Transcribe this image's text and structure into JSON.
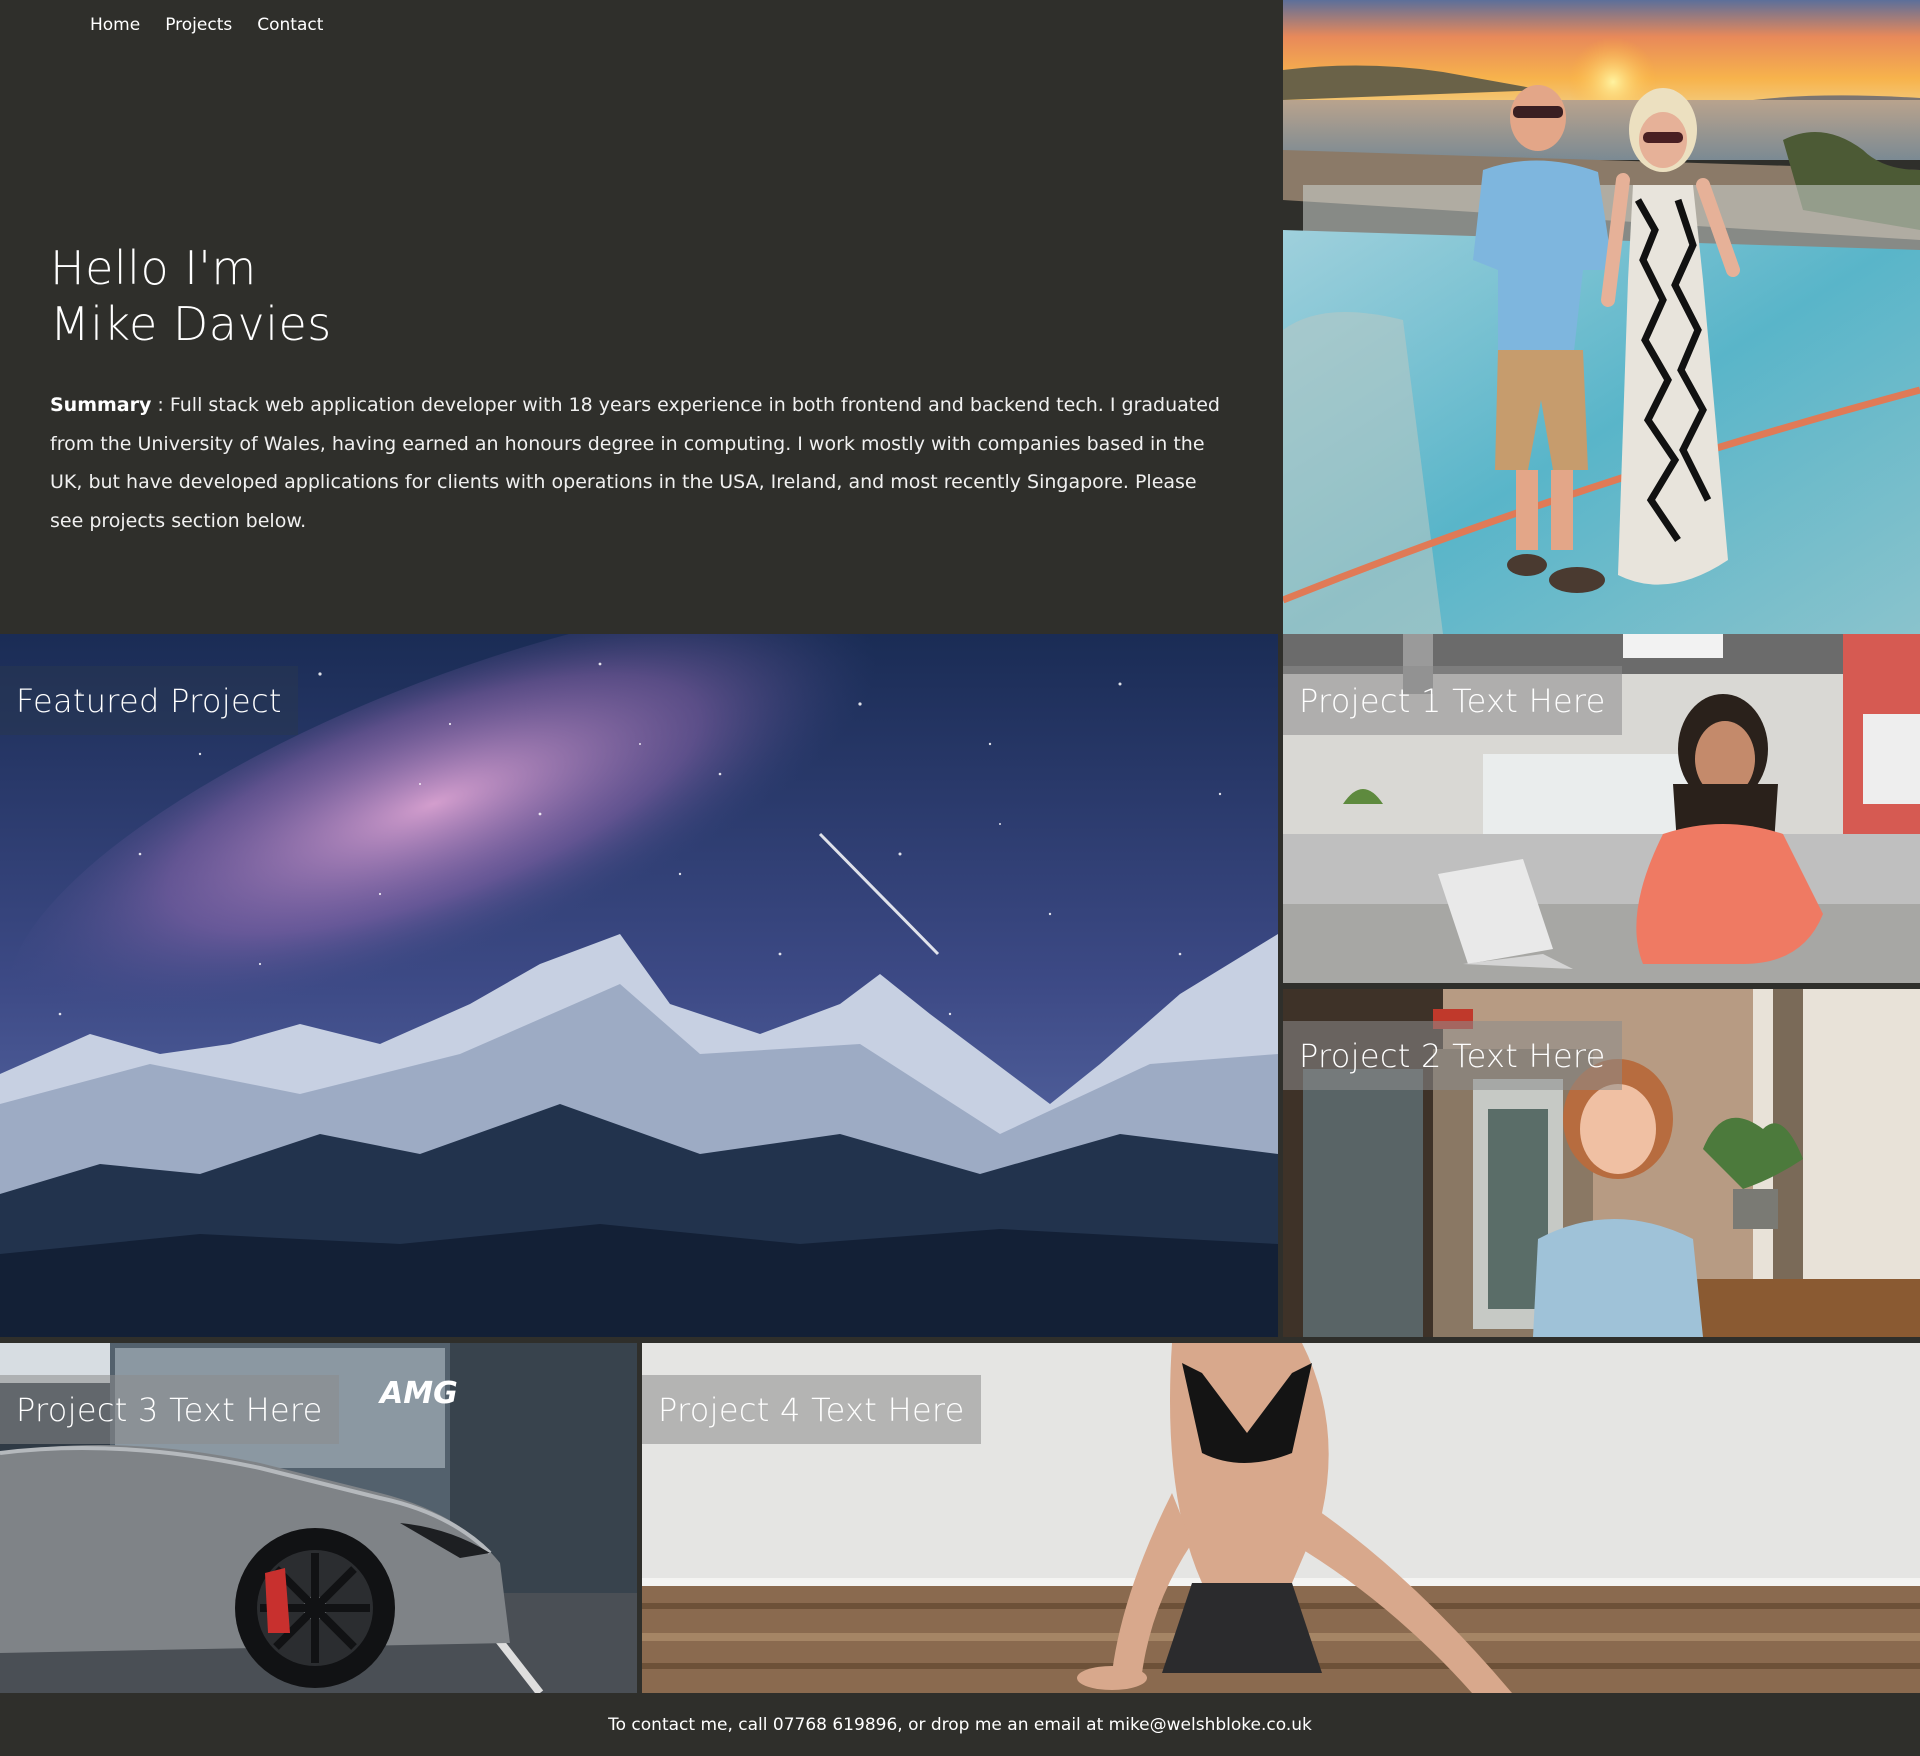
{
  "nav": {
    "items": [
      "Home",
      "Projects",
      "Contact"
    ]
  },
  "intro": {
    "hello_line1": "Hello I'm",
    "hello_line2": "Mike Davies",
    "summary_label": "Summary",
    "summary_text": " : Full stack web application developer with 18 years experience in both frontend and backend tech. I graduated from the University of Wales, having earned an honours degree in computing. I work mostly with companies based in the UK, but have developed applications for clients with operations in the USA, Ireland, and most recently Singapore. Please see projects section below."
  },
  "tiles": {
    "featured": "Featured Project",
    "p1": "Project 1 Text Here",
    "p2": "Project 2 Text Here",
    "p3": "Project 3 Text Here",
    "p4": "Project 4 Text Here"
  },
  "car_logo": "AMG",
  "footer": {
    "text": "To contact me, call 07768 619896, or drop me an email at mike@welshbloke.co.uk"
  }
}
